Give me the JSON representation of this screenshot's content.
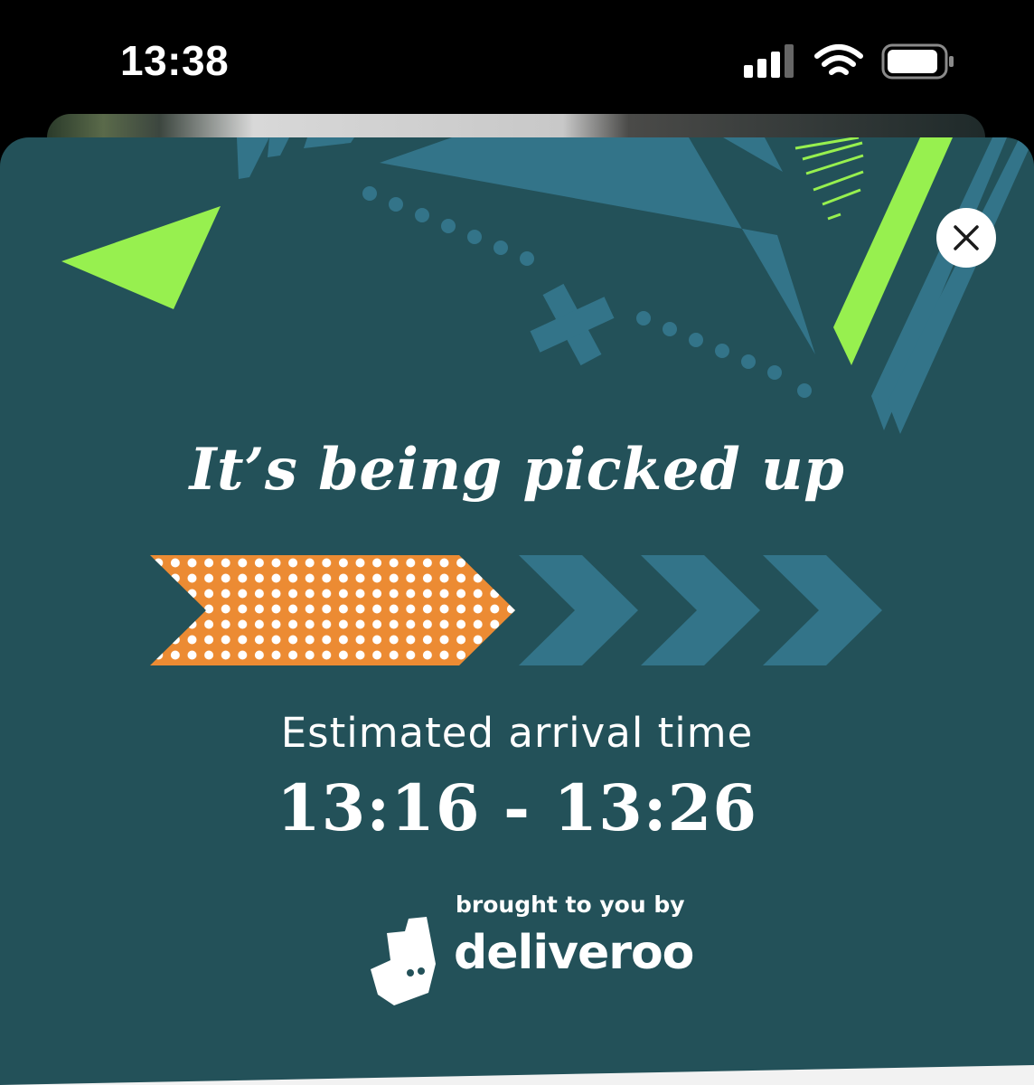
{
  "status_bar": {
    "time": "13:38"
  },
  "card": {
    "headline": "It’s being picked up",
    "progress": {
      "steps_total": 4,
      "steps_complete": 1
    },
    "eta_label": "Estimated arrival time",
    "eta_value": "13:16 - 13:26",
    "brought_by": "brought to you by",
    "brand": "deliveroo"
  },
  "colors": {
    "background": "#235159",
    "accent_green": "#97f04f",
    "accent_blue": "#337489",
    "progress_active": "#ec8b33",
    "text": "#ffffff"
  },
  "icons": {
    "close": "close-icon",
    "signal": "cellular-signal-icon",
    "wifi": "wifi-icon",
    "battery": "battery-icon",
    "brand_logo": "deliveroo-kangaroo-icon"
  }
}
